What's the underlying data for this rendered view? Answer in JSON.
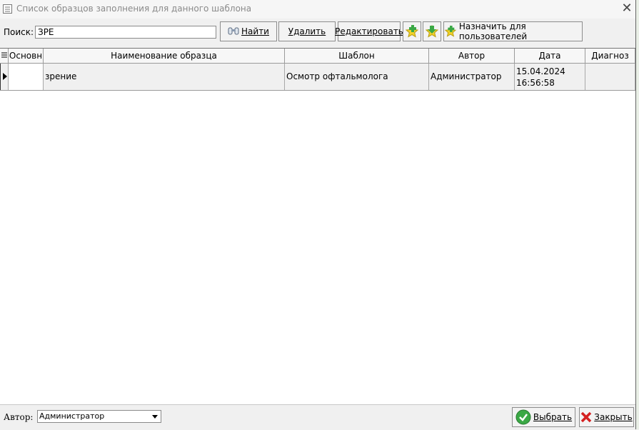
{
  "window": {
    "title": "Список образцов заполнения для данного шаблона",
    "window_icon": "form-list-icon",
    "close_icon": "close-icon"
  },
  "search": {
    "label": "Поиск:",
    "value": "ЗРЕ"
  },
  "toolbar": {
    "find_label": "Найти",
    "find_icon": "binoculars-icon",
    "delete_label": "Удалить",
    "edit_label": "Редактировать",
    "add_star_icon": "star-add-icon",
    "down_star_icon": "star-down-icon",
    "assign_label": "Назначить для пользователей",
    "assign_icon": "star-add-icon"
  },
  "table": {
    "columns": [
      "Основн",
      "Наименование образца",
      "Шаблон",
      "Автор",
      "Дата",
      "Диагноз"
    ],
    "rows": [
      {
        "main": "",
        "name": "зрение",
        "template": "Осмотр офтальмолога",
        "author": "Администратор",
        "date": "15.04.2024",
        "time": "16:56:58",
        "diagnosis": ""
      }
    ]
  },
  "footer": {
    "author_label": "Автор:",
    "author_value": "Администратор",
    "select_label": "Выбрать",
    "close_label": "Закрыть"
  },
  "colors": {
    "accent_green": "#3aa845",
    "close_red": "#d42020",
    "star_yellow": "#f2d22a"
  }
}
